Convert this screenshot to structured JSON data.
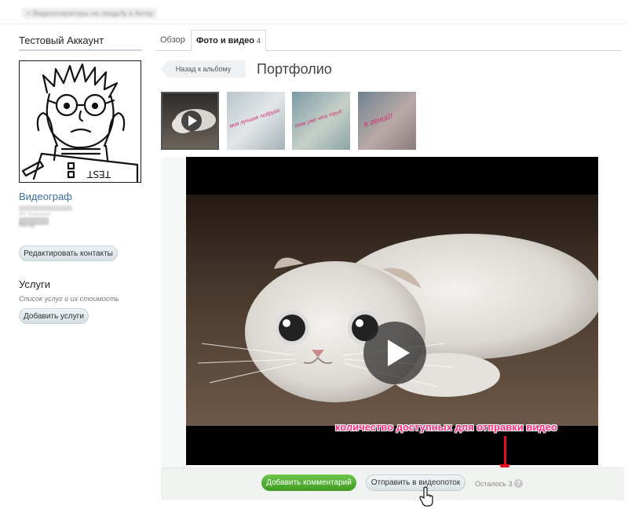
{
  "breadcrumb": "< Видеооператоры на свадьбу в Актау",
  "sidebar": {
    "account_name": "Тестовый Аккаунт",
    "role": "Видеограф",
    "company": "ИП \"Компания\"",
    "city": "Актау",
    "edit_contacts_label": "Редактировать контакты",
    "services_title": "Услуги",
    "services_subtitle": "Список услуг и их стоимость",
    "add_services_label": "Добавить услуги"
  },
  "tabs": {
    "overview": "Обзор",
    "photo_video": "Фото и видео",
    "photo_video_count": "4"
  },
  "album": {
    "back_label": "Назад к альбому",
    "title": "Портфолио"
  },
  "thumbnails": [
    {
      "caption": ""
    },
    {
      "caption": "моя лучшая подруга"
    },
    {
      "caption": "там уже что труд"
    },
    {
      "caption": "я гений!"
    }
  ],
  "annotation": "количество доступных для отправки видео",
  "actions": {
    "add_comment": "Добавить комментарий",
    "send_to_stream": "Отправить в видеопоток",
    "remaining": "Осталось 3",
    "help_glyph": "?"
  }
}
